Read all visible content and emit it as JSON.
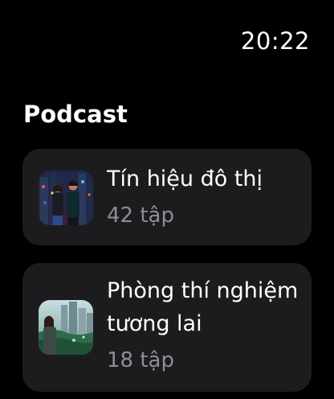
{
  "status": {
    "time": "20:22"
  },
  "section": {
    "title": "Podcast"
  },
  "podcasts": [
    {
      "title": "Tín hiệu đô thị",
      "episodes": "42 tập",
      "artwork_icon": "city-night-couple-artwork"
    },
    {
      "title": "Phòng thí nghiệm tương lai",
      "episodes": "18 tập",
      "artwork_icon": "future-lab-skyline-artwork"
    }
  ]
}
